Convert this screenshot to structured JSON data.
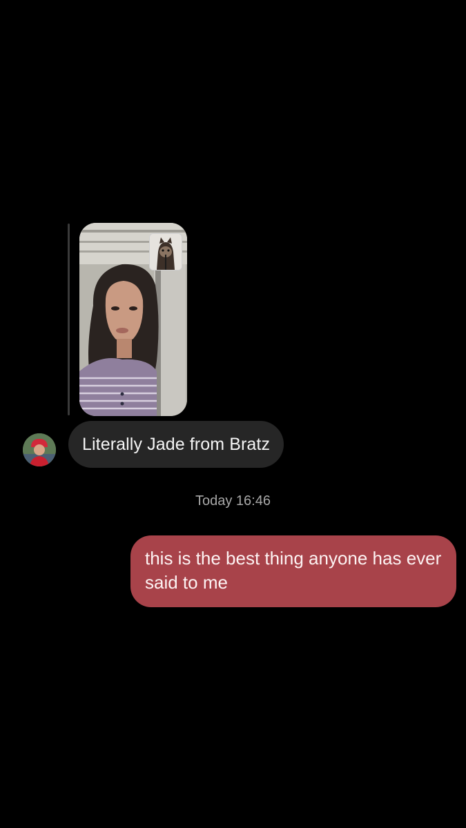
{
  "conversation": {
    "incoming_message": {
      "text": "Literally Jade from Bratz"
    },
    "timestamp": "Today 16:46",
    "outgoing_message": {
      "text": "this is the best thing anyone has ever said to me"
    }
  },
  "colors": {
    "background": "#000000",
    "incoming_bubble": "#262626",
    "outgoing_bubble": "#a8434a",
    "timestamp_text": "#a8a8a8"
  }
}
